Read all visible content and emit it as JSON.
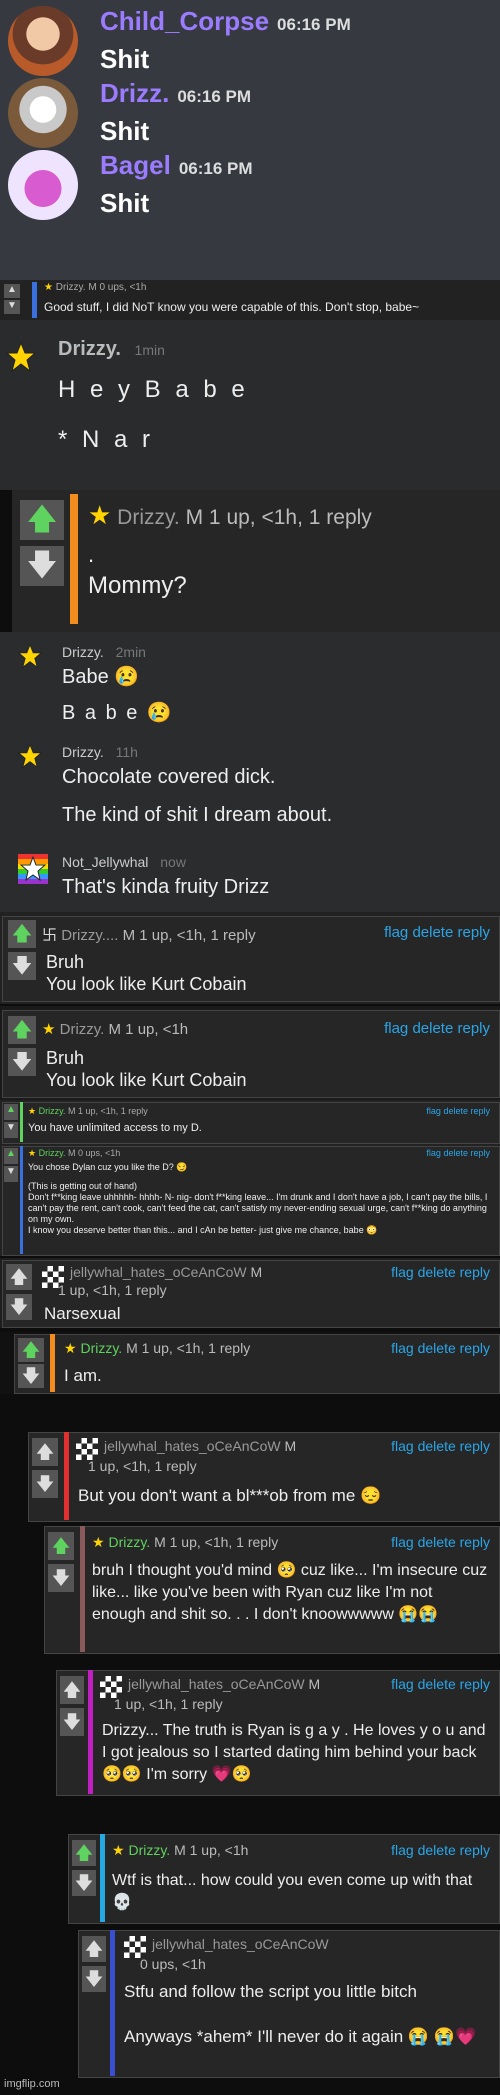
{
  "discord": {
    "messages": [
      {
        "user": "Child_Corpse",
        "time": "06:16 PM",
        "text": "Shit"
      },
      {
        "user": "Drizz.",
        "time": "06:16 PM",
        "text": "Shit"
      },
      {
        "user": "Bagel",
        "time": "06:16 PM",
        "text": "Shit"
      }
    ]
  },
  "c1": {
    "user": "Drizzy.",
    "meta": "M   0 ups, <1h",
    "text": "Good stuff, I did NoT know you were capable of this. Don't stop, babe~"
  },
  "c2": {
    "user": "Drizzy.",
    "time": "1min",
    "line1": "H e y B a b e",
    "line2": "* N a r"
  },
  "c3": {
    "user": "Drizzy.",
    "meta": "M   1 up, <1h, 1 reply",
    "line1": ".",
    "line2": "Mommy?"
  },
  "c4": {
    "user": "Drizzy.",
    "time": "2min",
    "line1": "Babe 😢",
    "line2": "B a b e 😢"
  },
  "c5": {
    "user": "Drizzy.",
    "time": "11h",
    "line1": "Chocolate covered dick.",
    "line2": "The kind of shit I dream about."
  },
  "c6": {
    "user": "Not_Jellywhal",
    "time": "now",
    "text": "That's kinda fruity Drizz"
  },
  "c7": {
    "user": "Drizzy....",
    "meta": "M   1 up, <1h, 1 reply",
    "line1": "Bruh",
    "line2": "You look like Kurt Cobain"
  },
  "c8": {
    "user": "Drizzy.",
    "meta": "M   1 up, <1h",
    "line1": "Bruh",
    "line2": "You look like Kurt Cobain"
  },
  "c9": {
    "user": "Drizzy.",
    "meta": "M   1 up, <1h, 1 reply",
    "text": "You have unlimited access to my D."
  },
  "c10": {
    "user": "Drizzy.",
    "meta": "M   0 ups, <1h",
    "l1": "You chose Dylan cuz you like the D? 😏",
    "l2": "(This is getting out of hand)",
    "l3": "Don't f**king leave uhhhhh- hhhh- N- nig- don't f**king leave... I'm drunk and I don't have a job, I can't pay the bills, I can't pay the rent, can't cook, can't feed the cat, can't satisfy my never-ending sexual urge, can't f**king do anything on my own.",
    "l4": "I know you deserve better than this... and I cAn be better- just give me chance, babe 😳"
  },
  "c11": {
    "user": "jellywhal_hates_oCeAnCoW",
    "m": "M",
    "meta": "1 up, <1h, 1 reply",
    "text": "Narsexual"
  },
  "c12": {
    "user": "Drizzy.",
    "meta": "M   1 up, <1h, 1 reply",
    "text": "I am."
  },
  "c13": {
    "user": "jellywhal_hates_oCeAnCoW",
    "m": "M",
    "meta": "1 up, <1h, 1 reply",
    "text": "But you don't want a bl***ob from me 😔"
  },
  "c14": {
    "user": "Drizzy.",
    "meta": "M   1 up, <1h, 1 reply",
    "text": "bruh I thought you'd mind 🥺 cuz like... I'm insecure cuz like... like you've been with Ryan cuz like I'm not enough and shit so. . . I don't knoowwwww 😭😭"
  },
  "c15": {
    "user": "jellywhal_hates_oCeAnCoW",
    "m": "M",
    "meta": "1 up, <1h, 1 reply",
    "text": "Drizzy... The truth is Ryan is g a y . He loves y o u and I got jealous so I started dating him behind your back 🥺🥺 I'm sorry 💗🥺"
  },
  "c16": {
    "user": "Drizzy.",
    "meta": "M   1 up, <1h",
    "text": "Wtf is that... how could you even come up with that 💀"
  },
  "c17": {
    "user": "jellywhal_hates_oCeAnCoW",
    "meta": "0 ups, <1h",
    "line1": "Stfu and follow the script you little bitch",
    "line2": "Anyways *ahem* I'll never do it again 😭 😭💗"
  },
  "links": {
    "flag": "flag",
    "delete": "delete",
    "reply": "reply"
  },
  "watermark": "imgflip.com",
  "colors": {
    "link": "#2aa6e8",
    "drizzyName": "#5fc1e8",
    "orange": "#f28c1e"
  }
}
